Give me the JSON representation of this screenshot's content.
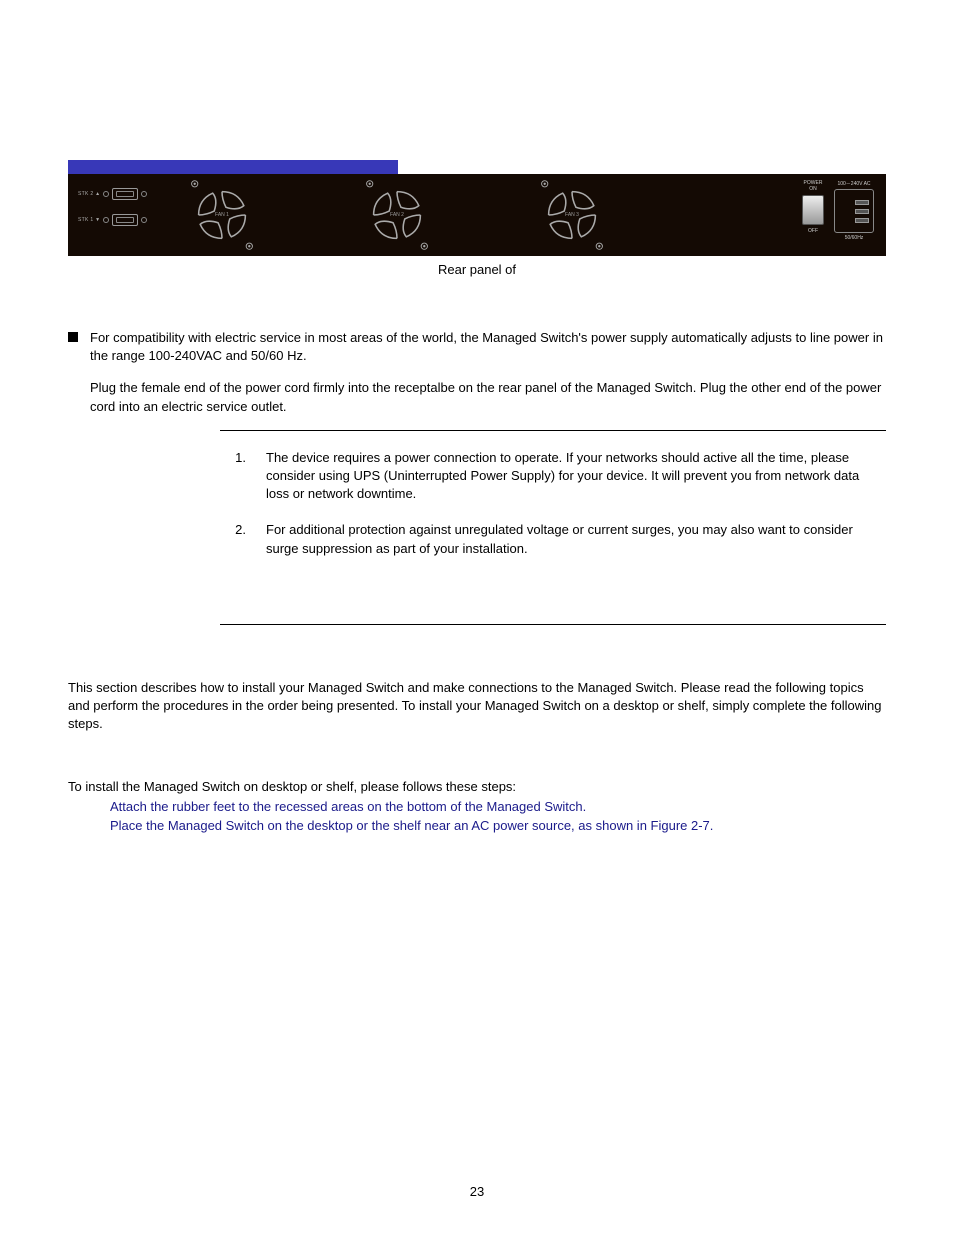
{
  "panel": {
    "stk1": "STK 2 ▲",
    "stk2": "STK 1 ▼",
    "fan1": "FAN 1",
    "fan2": "FAN 2",
    "fan3": "FAN 3",
    "power_on": "POWER\nON",
    "power_off": "OFF",
    "ac_top": "100－240V AC",
    "ac_bottom": "50/60Hz"
  },
  "caption": "Rear panel of",
  "compat": "For compatibility with electric service in most areas of the world, the Managed Switch's power supply automatically adjusts to line power in the range 100-240VAC and 50/60 Hz.",
  "plug": "Plug the female end of the power cord firmly into the receptalbe on the rear panel of the Managed Switch. Plug the other end of the power cord into an electric service outlet.",
  "notes": {
    "n1_num": "1.",
    "n1": "The device requires a power connection to operate. If your networks should active all the time, please consider using UPS (Uninterrupted Power Supply) for your device. It will prevent you from network data loss or network downtime.",
    "n2_num": "2.",
    "n2": "For additional protection against unregulated voltage or current surges, you may also want to consider surge suppression as part of your installation."
  },
  "desc": "This section describes how to install your Managed Switch and make connections to the Managed Switch. Please read the following topics and perform the procedures in the order being presented. To install your Managed Switch on a desktop or shelf, simply complete the following steps.",
  "steps_intro": "To install the Managed Switch on desktop or shelf, please follows these steps:",
  "step1": "Attach the rubber feet to the recessed areas on the bottom of the Managed Switch.",
  "step2": "Place the Managed Switch on the desktop or the shelf near an AC power source, as shown in Figure 2-7.",
  "page": "23"
}
